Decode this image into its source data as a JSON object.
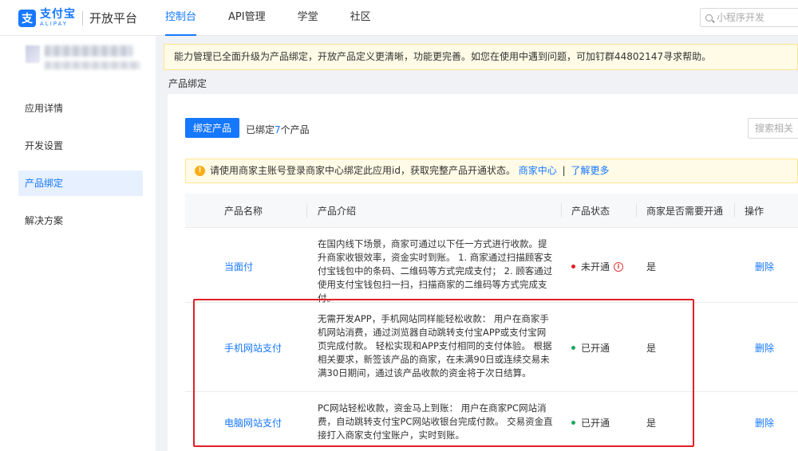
{
  "brand": {
    "logo_glyph": "支",
    "name_cn": "支付宝",
    "name_en": "ALIPAY",
    "platform": "开放平台",
    "color": "#1677ff"
  },
  "nav": {
    "items": [
      {
        "label": "控制台",
        "active": true
      },
      {
        "label": "API管理",
        "active": false
      },
      {
        "label": "学堂",
        "active": false
      },
      {
        "label": "社区",
        "active": false
      }
    ],
    "search_placeholder": "小程序开发"
  },
  "sidebar": {
    "items": [
      {
        "label": "应用详情",
        "active": false
      },
      {
        "label": "开发设置",
        "active": false
      },
      {
        "label": "产品绑定",
        "active": true
      },
      {
        "label": "解决方案",
        "active": false
      }
    ]
  },
  "notice": {
    "text": "能力管理已全面升级为产品绑定，开放产品定义更清晰，功能更完善。如您在使用中遇到问题，可加钉群44802147寻求帮助。"
  },
  "breadcrumb": "产品绑定",
  "toolbar": {
    "bind_button": "绑定产品",
    "bound_prefix": "已绑定",
    "bound_count": "7",
    "bound_suffix": "个产品",
    "search_placeholder": "搜索相关"
  },
  "alert": {
    "text": "请使用商家主账号登录商家中心绑定此应用id，获取完整产品开通状态。",
    "link_merchant": "商家中心",
    "separator": "|",
    "link_more": "了解更多"
  },
  "table": {
    "headers": {
      "name": "产品名称",
      "intro": "产品介绍",
      "status": "产品状态",
      "need_open": "商家是否需要开通",
      "action": "操作"
    },
    "rows": [
      {
        "name": "当面付",
        "intro": "在国内线下场景，商家可通过以下任一方式进行收款。提升商家收银效率，资金实时到账。 1. 商家通过扫描顾客支付宝钱包中的条码、二维码等方式完成支付； 2. 顾客通过使用支付宝钱包扫一扫，扫描商家的二维码等方式完成支付。",
        "status": "未开通",
        "status_color": "#e02020",
        "has_info": true,
        "need_open": "是",
        "action": "删除"
      },
      {
        "name": "手机网站支付",
        "intro": "无需开发APP，手机网站同样能轻松收款： 用户在商家手机网站消费，通过浏览器自动跳转支付宝APP或支付宝网页完成付款。 轻松实现和APP支付相同的支付体验。 根据相关要求，新签该产品的商家，在未满90日或连续交易未满30日期间，通过该产品收款的资金将于次日结算。",
        "status": "已开通",
        "status_color": "#21a560",
        "has_info": false,
        "need_open": "是",
        "action": "删除"
      },
      {
        "name": "电脑网站支付",
        "intro": "PC网站轻松收款，资金马上到账： 用户在商家PC网站消费，自动跳转支付宝PC网站收银台完成付款。 交易资金直接打入商家支付宝账户，实时到账。",
        "status": "已开通",
        "status_color": "#21a560",
        "has_info": false,
        "need_open": "是",
        "action": "删除"
      }
    ]
  }
}
